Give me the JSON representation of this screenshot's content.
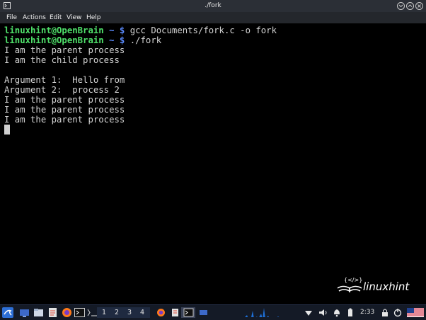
{
  "window": {
    "title": "./fork"
  },
  "menu": {
    "file": "File",
    "actions": "Actions",
    "edit": "Edit",
    "view": "View",
    "help": "Help"
  },
  "terminal": {
    "prompt_user": "linuxhint@OpenBrain",
    "prompt_tilde": "~",
    "prompt_dollar": "$",
    "cmd1": " gcc Documents/fork.c -o fork",
    "cmd2": " ./fork",
    "output": [
      "I am the parent process",
      "I am the child process",
      "",
      "Argument 1:  Hello from",
      "Argument 2:  process 2",
      "I am the parent process",
      "I am the parent process",
      "I am the parent process"
    ]
  },
  "watermark": {
    "text": "linuxhint"
  },
  "taskbar": {
    "workspaces": [
      "1",
      "2",
      "3",
      "4"
    ],
    "clock": "2:33",
    "icons": [
      "kali-menu-icon",
      "show-desktop-icon",
      "file-manager-icon",
      "text-editor-icon",
      "firefox-icon",
      "terminal-icon",
      "firefox-window-icon",
      "editor-window-icon",
      "terminal-window-icon",
      "window-icon",
      "network-icon",
      "volume-icon",
      "notification-icon",
      "battery-icon",
      "power-icon",
      "flag-icon"
    ]
  }
}
